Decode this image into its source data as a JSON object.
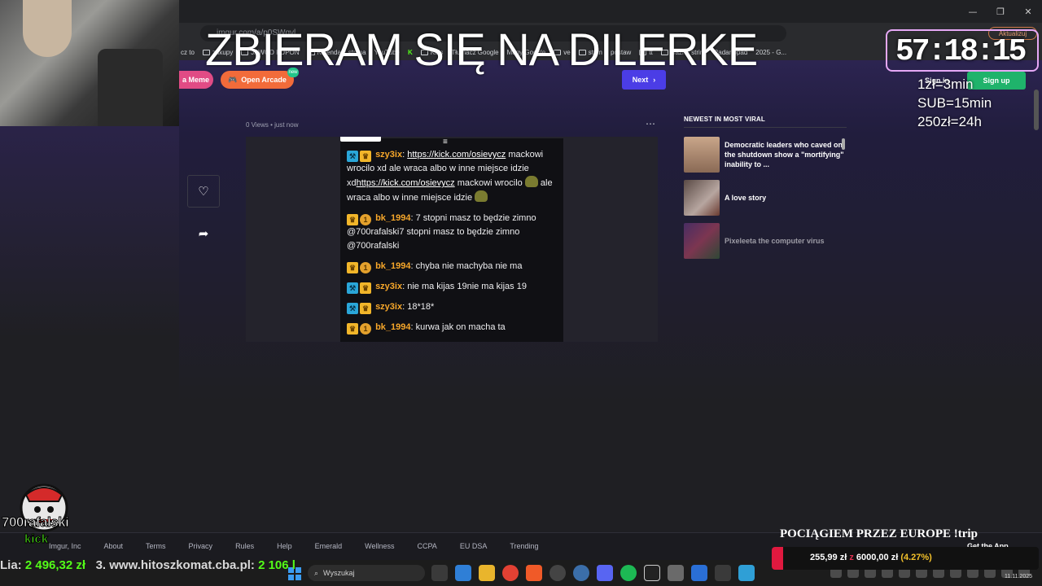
{
  "browser": {
    "url": "imgur.com/a/p0SWqvl",
    "update_label": "Aktualizuj",
    "bookmarks": [
      "cz to",
      "zakupy",
      "JAWOD KUPON",
      "Kalendarz strima",
      "YouTube",
      "K",
      "Kals",
      "Tłumacz Google",
      "Mapy Google",
      "ve",
      "strim",
      "",
      "postaw",
      "tt",
      "ważne strim",
      "Radar opad",
      "2025 - G..."
    ],
    "win_controls": [
      "—",
      "❐",
      "✕"
    ]
  },
  "imgur": {
    "meme_label": "a Meme",
    "arcade_label": "Open Arcade",
    "arcade_badge": "new",
    "next_label": "Next",
    "signin_label": "Sign in",
    "signup_label": "Sign up",
    "views": "0 Views",
    "time": "just now",
    "sidebar_title": "NEWEST IN MOST VIRAL",
    "sidebar_items": [
      {
        "title": "Democratic leaders who caved on the shutdown show a \"mortifying\" inability to ..."
      },
      {
        "title": "A love story"
      },
      {
        "title": "Pixeleeta the computer virus"
      }
    ],
    "footer_links": [
      "Imgur, Inc",
      "About",
      "Terms",
      "Privacy",
      "Rules",
      "Help",
      "Emerald",
      "Wellness",
      "CCPA",
      "EU DSA",
      "Trending"
    ],
    "get_app": "Get the App"
  },
  "chat": {
    "messages": [
      {
        "user": "szy3ix",
        "pre": ": ",
        "link": "https://kick.com/osievycz",
        "text1": " mackowi wrocilo xd ale wraca albo w inne miejsce idzie xd",
        "link2": "https://kick.com/osievycz",
        "text2": " mackowi wrocilo ",
        "text3": " ale wraca albo w inne miejsce idzie "
      },
      {
        "user": "bk_1994",
        "text": ": 7 stopni masz to będzie zimno @700rafalski7 stopni masz to będzie zimno @700rafalski"
      },
      {
        "user": "bk_1994",
        "text": ": chyba nie machyba nie ma"
      },
      {
        "user": "szy3ix",
        "text": ": nie ma kijas 19nie ma kijas 19"
      },
      {
        "user": "szy3ix",
        "text": ": 18*18*"
      },
      {
        "user": "bk_1994",
        "text": ": kurwa jak on macha ta"
      }
    ]
  },
  "overlay": {
    "headline": "ZBIERAM SIĘ NA DILERKE",
    "timer": "57:18:15",
    "rates": [
      "1zł=3min",
      "SUB=15min",
      "250zł=24h"
    ],
    "logo_name": "700rafalski",
    "logo_kick": "kick",
    "ticker_prefix": "Lia: ",
    "ticker_amount": "2 496,32 zł",
    "ticker_mid": "   3. www.hitoszkomat.cba.pl: ",
    "ticker_amount2": "2 106 l",
    "goal_title": "POCIĄGIEM PRZEZ EUROPE !trip",
    "goal_current": "255,99 zł",
    "goal_sep": " z ",
    "goal_target": "6000,00 zł",
    "goal_percent": "(4.27%)",
    "goal_fraction": 0.0427
  },
  "taskbar": {
    "search_placeholder": "Wyszukaj",
    "time": "14:09",
    "date": "11.11.2025"
  }
}
